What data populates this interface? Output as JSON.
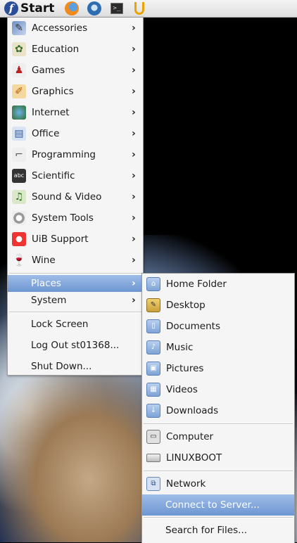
{
  "panel": {
    "start_label": "Start",
    "launchers": [
      "firefox-icon",
      "thunderbird-icon",
      "terminal-icon",
      "uib-logo-icon"
    ]
  },
  "main_menu": {
    "items": [
      {
        "label": "Accessories",
        "icon": "accessories-icon"
      },
      {
        "label": "Education",
        "icon": "education-icon"
      },
      {
        "label": "Games",
        "icon": "games-icon"
      },
      {
        "label": "Graphics",
        "icon": "graphics-icon"
      },
      {
        "label": "Internet",
        "icon": "internet-icon"
      },
      {
        "label": "Office",
        "icon": "office-icon"
      },
      {
        "label": "Programming",
        "icon": "programming-icon"
      },
      {
        "label": "Scientific",
        "icon": "scientific-icon"
      },
      {
        "label": "Sound & Video",
        "icon": "sound-video-icon"
      },
      {
        "label": "System Tools",
        "icon": "system-tools-icon"
      },
      {
        "label": "UiB Support",
        "icon": "lifebuoy-icon"
      },
      {
        "label": "Wine",
        "icon": "wine-icon"
      }
    ],
    "places_label": "Places",
    "system_label": "System",
    "lock_label": "Lock Screen",
    "logout_label": "Log Out st01368...",
    "shutdown_label": "Shut Down..."
  },
  "places_menu": {
    "items": [
      {
        "label": "Home Folder",
        "icon": "home-folder-icon"
      },
      {
        "label": "Desktop",
        "icon": "desktop-folder-icon"
      },
      {
        "label": "Documents",
        "icon": "documents-folder-icon"
      },
      {
        "label": "Music",
        "icon": "music-folder-icon"
      },
      {
        "label": "Pictures",
        "icon": "pictures-folder-icon"
      },
      {
        "label": "Videos",
        "icon": "videos-folder-icon"
      },
      {
        "label": "Downloads",
        "icon": "downloads-folder-icon"
      }
    ],
    "computer_label": "Computer",
    "linuxboot_label": "LINUXBOOT",
    "network_label": "Network",
    "connect_label": "Connect to Server...",
    "search_label": "Search for Files..."
  },
  "colors": {
    "selection": "#7fa3d8",
    "menu_bg": "#f5f5f5"
  }
}
